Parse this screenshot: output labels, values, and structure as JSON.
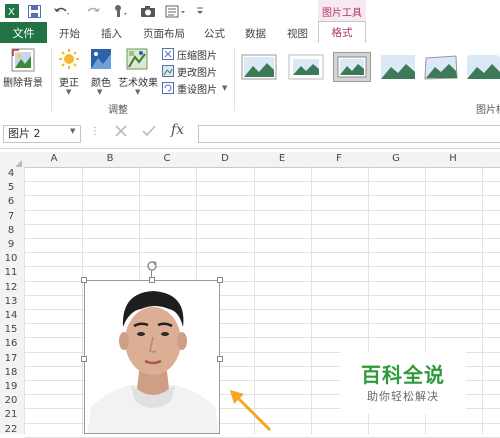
{
  "ribbon_tabs": {
    "file": "文件",
    "home": "开始",
    "insert": "插入",
    "page_layout": "页面布局",
    "formulas": "公式",
    "data": "数据",
    "view": "视图",
    "format": "格式"
  },
  "context_tab_group": "图片工具",
  "ribbon": {
    "remove_background": "删除背景",
    "corrections": "更正",
    "color": "颜色",
    "artistic_effects": "艺术效果",
    "compress_pictures": "压缩图片",
    "change_picture": "更改图片",
    "reset_picture": "重设图片",
    "adjust_group": "调整",
    "styles_group": "图片样"
  },
  "formula_bar": {
    "name_box": "图片 2",
    "fx": "fx",
    "formula": ""
  },
  "columns": [
    "A",
    "B",
    "C",
    "D",
    "E",
    "F",
    "G",
    "H"
  ],
  "rows": [
    "4",
    "5",
    "6",
    "7",
    "8",
    "9",
    "10",
    "11",
    "12",
    "13",
    "14",
    "15",
    "16",
    "17",
    "18",
    "19",
    "20",
    "21",
    "22"
  ],
  "watermark": {
    "title": "百科全说",
    "subtitle": "助你轻松解决"
  },
  "colors": {
    "excel_green": "#217346",
    "context_pink": "#b0306b",
    "watermark_green": "#2e9a3a",
    "arrow_orange": "#f5a623"
  }
}
